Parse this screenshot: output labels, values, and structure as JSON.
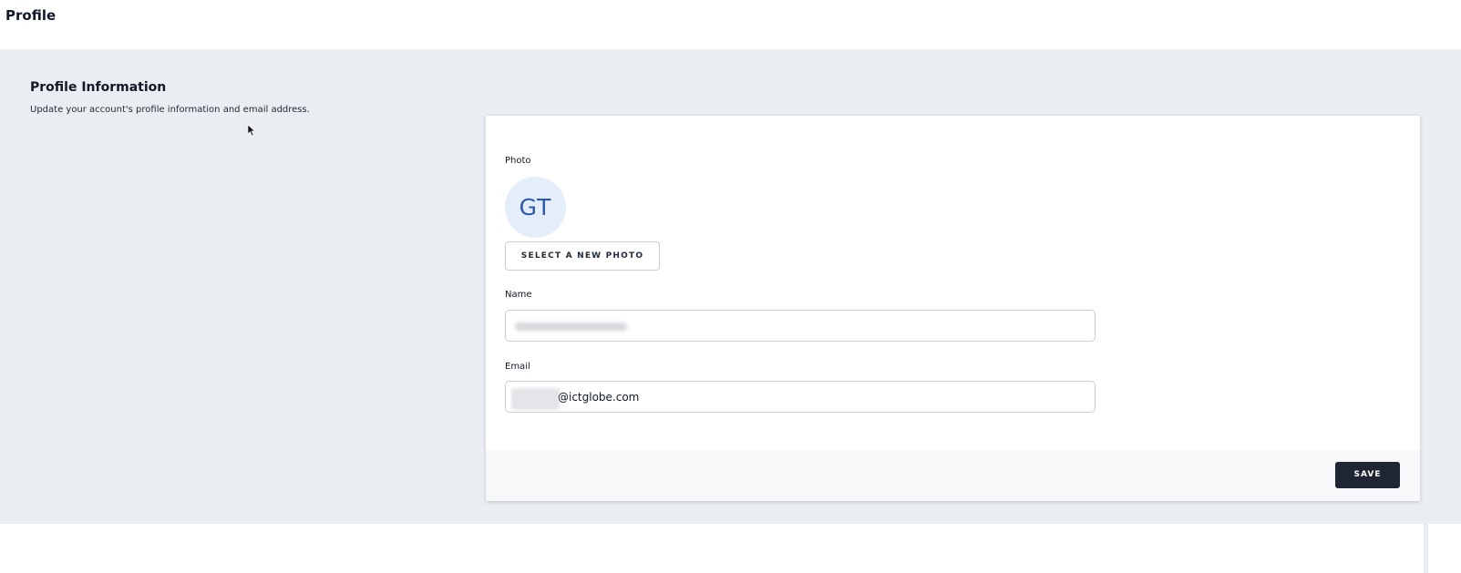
{
  "header": {
    "title": "Profile"
  },
  "section": {
    "title": "Profile Information",
    "description": "Update your account's profile information and email address."
  },
  "form": {
    "photo_label": "Photo",
    "avatar_initials": "GT",
    "select_photo_label": "SELECT A NEW PHOTO",
    "name_label": "Name",
    "email_label": "Email",
    "email_domain": "@ictglobe.com",
    "save_label": "SAVE"
  },
  "colors": {
    "page_background": "#eaedf1",
    "avatar_background": "#e4eefb",
    "avatar_text": "#2f5aa8",
    "save_button": "#1f2533"
  },
  "icons": {
    "cursor": "mouse-pointer-icon"
  }
}
